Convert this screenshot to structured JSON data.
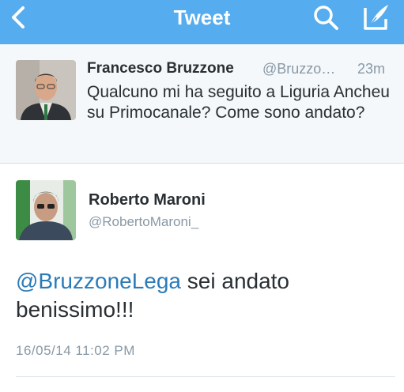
{
  "nav": {
    "title": "Tweet"
  },
  "reply_tweet": {
    "name": "Francesco Bruzzone",
    "handle": "@Bruzzo…",
    "time": "23m",
    "text": "Qualcuno mi ha seguito a Liguria Ancheu su Primocanale? Come sono andato?"
  },
  "main_tweet": {
    "name": "Roberto Maroni",
    "handle": "@RobertoMaroni_",
    "mention": "@BruzzoneLega",
    "text": " sei andato benissimo!!!",
    "date": "16/05/14 11:02 PM"
  },
  "colors": {
    "nav_bg": "#55acee",
    "link": "#2b7bb9",
    "muted": "#8899a6",
    "text": "#292f33"
  },
  "icons": [
    "back-chevron-icon",
    "search-icon",
    "compose-tweet-icon"
  ]
}
